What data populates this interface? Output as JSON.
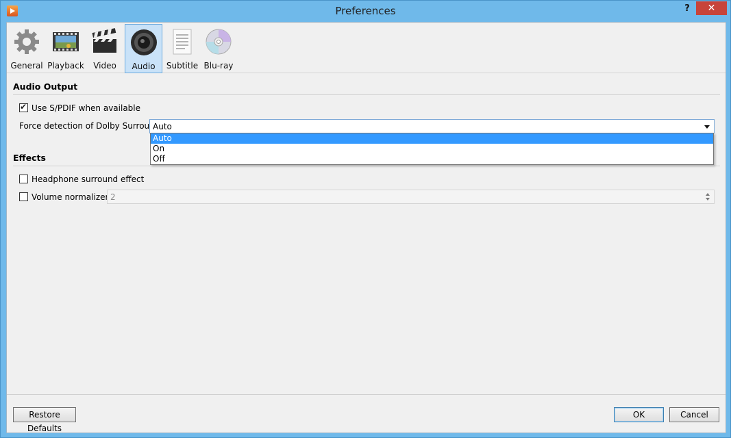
{
  "window": {
    "title": "Preferences",
    "help": "?",
    "close": "✕"
  },
  "toolbar": {
    "items": [
      {
        "label": "General",
        "icon": "gear-icon"
      },
      {
        "label": "Playback",
        "icon": "film-strip-icon"
      },
      {
        "label": "Video",
        "icon": "clapperboard-icon"
      },
      {
        "label": "Audio",
        "icon": "speaker-icon",
        "selected": true
      },
      {
        "label": "Subtitle",
        "icon": "document-icon"
      },
      {
        "label": "Blu-ray",
        "icon": "disc-icon"
      }
    ]
  },
  "audio_output": {
    "title": "Audio Output",
    "spdif_label": "Use S/PDIF when available",
    "spdif_checked": true,
    "dolby_label": "Force detection of Dolby Surround:",
    "dolby_value": "Auto",
    "dolby_options": [
      "Auto",
      "On",
      "Off"
    ]
  },
  "effects": {
    "title": "Effects",
    "headphone_label": "Headphone surround effect",
    "headphone_checked": false,
    "normalizer_label": "Volume normalizer",
    "normalizer_checked": false,
    "normalizer_value": "2"
  },
  "footer": {
    "restore": "Restore Defaults",
    "ok": "OK",
    "cancel": "Cancel"
  },
  "colors": {
    "accent": "#3399ff",
    "selected_tab": "#c9e2f8",
    "close": "#c7443a"
  }
}
